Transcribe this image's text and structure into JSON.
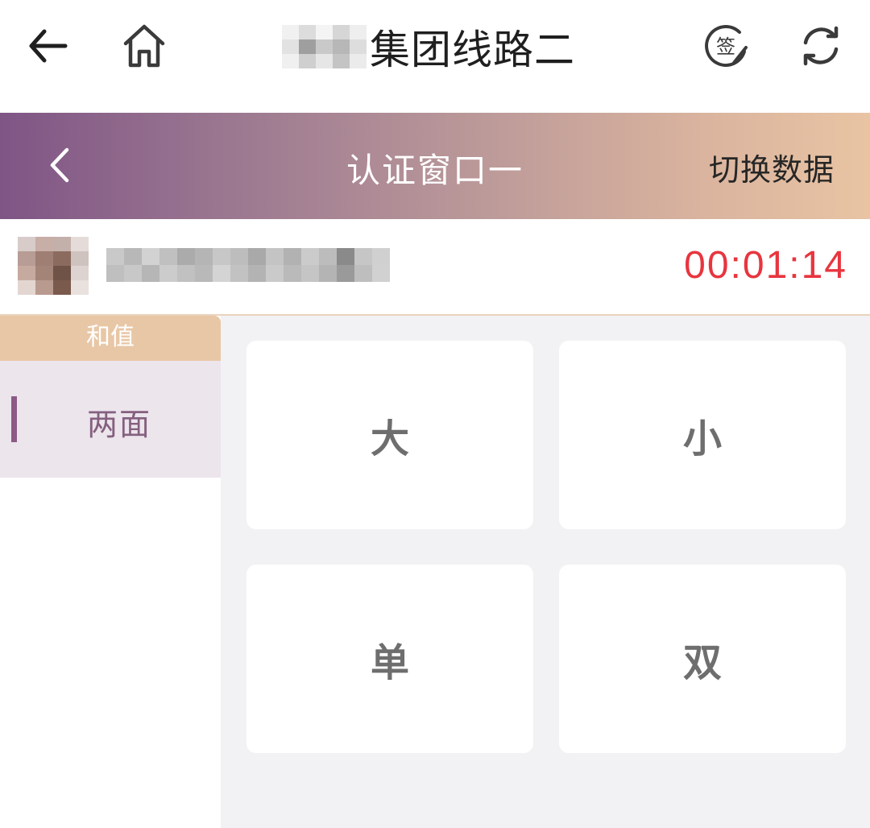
{
  "top_bar": {
    "back_icon": "arrow-left-icon",
    "home_icon": "home-icon",
    "title": "集团线路二",
    "sign_icon": "sign-icon",
    "sign_icon_text": "签",
    "refresh_icon": "refresh-icon"
  },
  "header": {
    "back_icon": "chevron-left-icon",
    "title": "认证窗口一",
    "switch_label": "切换数据"
  },
  "info": {
    "timer": "00:01:14"
  },
  "menu": {
    "section_title": "和值",
    "items": [
      {
        "label": "两面",
        "selected": true
      }
    ]
  },
  "options": [
    {
      "label": "大"
    },
    {
      "label": "小"
    },
    {
      "label": "单"
    },
    {
      "label": "双"
    }
  ],
  "colors": {
    "timer": "#e8353f",
    "gradient_start": "#7f5585",
    "gradient_end": "#e9c4a3",
    "menu_header": "#e8c7a6",
    "menu_selected_bg": "#ece5ec",
    "menu_indicator": "#8b5a86"
  }
}
